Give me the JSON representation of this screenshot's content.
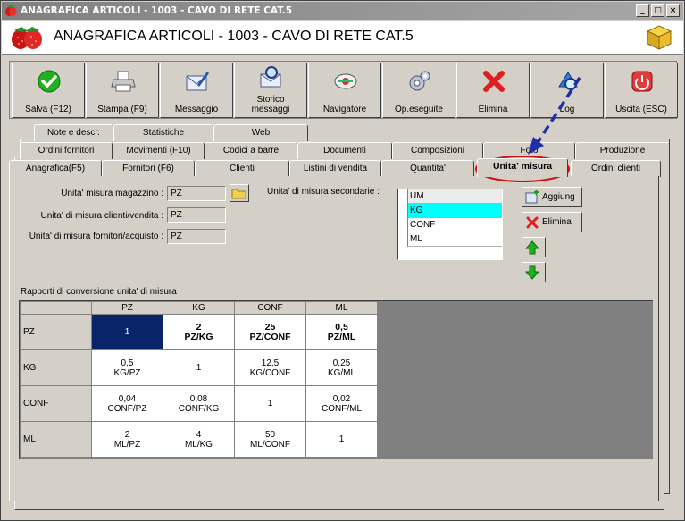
{
  "window": {
    "title": "ANAGRAFICA ARTICOLI - 1003 - CAVO DI RETE CAT.5",
    "minimize": "_",
    "maximize": "□",
    "close": "×"
  },
  "header": {
    "title": "ANAGRAFICA ARTICOLI - 1003 - CAVO DI RETE CAT.5"
  },
  "toolbar": {
    "items": [
      {
        "label": "Salva (F12)",
        "icon": "check-icon"
      },
      {
        "label": "Stampa (F9)",
        "icon": "printer-icon"
      },
      {
        "label": "Messaggio",
        "icon": "envelope-pen-icon"
      },
      {
        "label": "Storico\nmessaggi",
        "icon": "envelope-search-icon"
      },
      {
        "label": "Navigatore",
        "icon": "navigator-icon"
      },
      {
        "label": "Op.eseguite",
        "icon": "gears-icon"
      },
      {
        "label": "Elimina",
        "icon": "red-x-icon"
      },
      {
        "label": "Log",
        "icon": "log-search-icon"
      },
      {
        "label": "Uscita (ESC)",
        "icon": "power-icon"
      }
    ]
  },
  "tabs": {
    "row1": [
      "Note e descr.",
      "Statistiche",
      "Web"
    ],
    "row2": [
      "Ordini fornitori",
      "Movimenti (F10)",
      "Codici a barre",
      "Documenti",
      "Composizioni",
      "Foto",
      "Produzione"
    ],
    "row3": [
      "Anagrafica(F5)",
      "Fornitori (F6)",
      "Clienti",
      "Listini di vendita",
      "Quantita'",
      "Unita' misura",
      "Ordini clienti"
    ]
  },
  "units": {
    "warehouse_label": "Unita' misura magazzino :",
    "warehouse_value": "PZ",
    "customers_label": "Unita' di misura clienti/vendita :",
    "customers_value": "PZ",
    "suppliers_label": "Unita' di misura fornitori/acquisto :",
    "suppliers_value": "PZ",
    "secondary_label": "Unita' di misura secondarie :",
    "secondary_header": "UM",
    "secondary_items": [
      "KG",
      "CONF",
      "ML"
    ],
    "selected": "KG"
  },
  "buttons": {
    "add": "Aggiung",
    "delete": "Elimina"
  },
  "conversion": {
    "title": "Rapporti di conversione unita' di misura",
    "columns": [
      "PZ",
      "KG",
      "CONF",
      "ML"
    ],
    "rows": [
      {
        "unit": "PZ",
        "cells": [
          [
            "1",
            ""
          ],
          [
            "2",
            "PZ/KG"
          ],
          [
            "25",
            "PZ/CONF"
          ],
          [
            "0,5",
            "PZ/ML"
          ]
        ]
      },
      {
        "unit": "KG",
        "cells": [
          [
            "0,5",
            "KG/PZ"
          ],
          [
            "1",
            ""
          ],
          [
            "12,5",
            "KG/CONF"
          ],
          [
            "0,25",
            "KG/ML"
          ]
        ]
      },
      {
        "unit": "CONF",
        "cells": [
          [
            "0,04",
            "CONF/PZ"
          ],
          [
            "0,08",
            "CONF/KG"
          ],
          [
            "1",
            ""
          ],
          [
            "0,02",
            "CONF/ML"
          ]
        ]
      },
      {
        "unit": "ML",
        "cells": [
          [
            "2",
            "ML/PZ"
          ],
          [
            "4",
            "ML/KG"
          ],
          [
            "50",
            "ML/CONF"
          ],
          [
            "1",
            ""
          ]
        ]
      }
    ]
  },
  "colors": {
    "face": "#d4d0c8",
    "selection": "#0a246a",
    "list_selection": "#00ffff",
    "highlight_ellipse": "#cc1111",
    "arrow": "#1f2fa8"
  }
}
